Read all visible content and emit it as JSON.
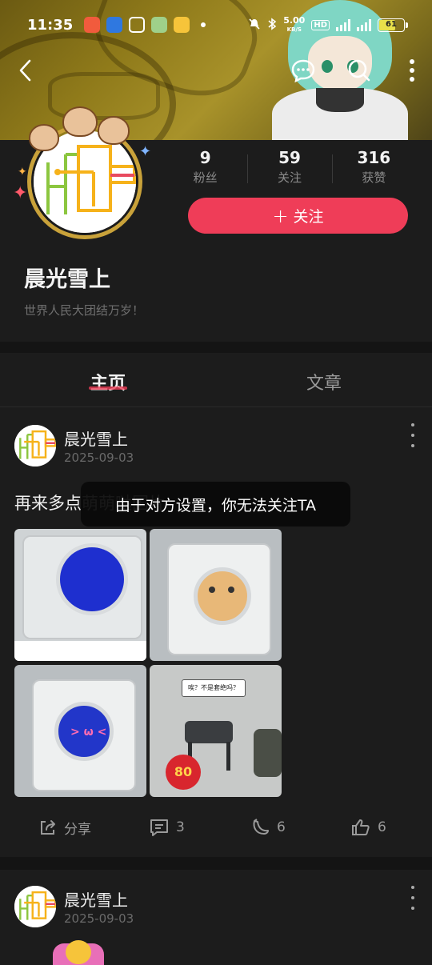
{
  "status_bar": {
    "time": "11:35",
    "speed_value": "5.00",
    "speed_unit": "KB/S",
    "hd_label": "HD",
    "battery": "61"
  },
  "nav": {
    "back_icon": "chevron-left-icon",
    "message_icon": "chat-bubble-icon",
    "search_icon": "search-icon",
    "more_icon": "more-vertical-icon"
  },
  "profile": {
    "name": "晨光雪上",
    "bio": "世界人民大团结万岁！",
    "stats": [
      {
        "num": "9",
        "label": "粉丝"
      },
      {
        "num": "59",
        "label": "关注"
      },
      {
        "num": "316",
        "label": "获赞"
      }
    ],
    "follow_label": "关注"
  },
  "tabs": [
    {
      "label": "主页",
      "active": true
    },
    {
      "label": "文章",
      "active": false
    }
  ],
  "posts": [
    {
      "author": "晨光雪上",
      "date": "2025-09-03",
      "text": "再来多点萌萌哒国片",
      "image_caption": "唉？不是套绝吗？",
      "image_badge": "80",
      "actions": {
        "share": "分享",
        "comments": "3",
        "gifts": "6",
        "likes": "6"
      }
    },
    {
      "author": "晨光雪上",
      "date": "2025-09-03"
    }
  ],
  "toast": "由于对方设置，你无法关注TA",
  "colors": {
    "accent": "#ef3d58",
    "background": "#1c1c1c"
  }
}
